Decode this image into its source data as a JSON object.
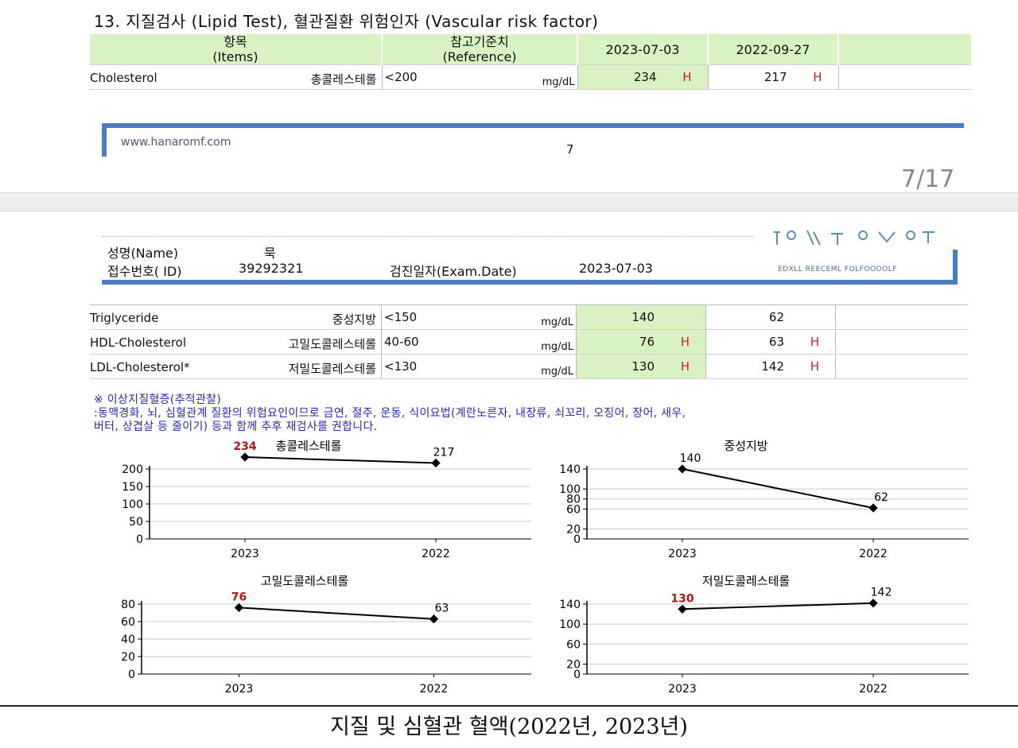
{
  "section_title": "13. 지질검사 (Lipid Test), 혈관질환 위험인자 (Vascular risk factor)",
  "header": {
    "items_ko": "항목",
    "items_en": "(Items)",
    "ref_ko": "참고기준치",
    "ref_en": "(Reference)",
    "date1": "2023-07-03",
    "date2": "2022-09-27"
  },
  "rows_top": [
    {
      "en": "Cholesterol",
      "ko": "총콜레스테롤",
      "ref": "<200",
      "unit": "mg/dL",
      "v1": "234",
      "f1": "H",
      "v2": "217",
      "f2": "H"
    }
  ],
  "footer_page": {
    "url": "www.hanaromf.com",
    "page_number": "7",
    "page_counter": "7/17"
  },
  "patient": {
    "name_label": "성명(Name)",
    "name_value": "묵",
    "id_label": "접수번호( ID)",
    "id_value": "39292321",
    "exam_label": "검진일자(Exam.Date)",
    "exam_value": "2023-07-03",
    "logo_text": "EDXLL REECEML FOLFOOOOLF"
  },
  "rows_bottom": [
    {
      "en": "Triglyceride",
      "ko": "중성지방",
      "ref": "<150",
      "unit": "mg/dL",
      "v1": "140",
      "f1": "",
      "v2": "62",
      "f2": ""
    },
    {
      "en": "HDL-Cholesterol",
      "ko": "고밀도콜레스테롤",
      "ref": "40-60",
      "unit": "mg/dL",
      "v1": "76",
      "f1": "H",
      "v2": "63",
      "f2": "H"
    },
    {
      "en": "LDL-Cholesterol*",
      "ko": "저밀도콜레스테롤",
      "ref": "<130",
      "unit": "mg/dL",
      "v1": "130",
      "f1": "H",
      "v2": "142",
      "f2": "H"
    }
  ],
  "note": {
    "line1": "※ 이상지질혈증(추적관찰)",
    "line2": ":동맥경화, 뇌, 심혈관계 질환의 위험요인이므로 금연, 절주, 운동, 식이요법(계란노른자, 내장류, 쇠꼬리, 오징어, 장어, 새우,",
    "line3": "버터, 상겹살 등 줄이기) 등과 함께 추후 재검사를 권합니다."
  },
  "chart_data": [
    {
      "type": "line",
      "title": "총콜레스테롤",
      "categories": [
        "2023",
        "2022"
      ],
      "values": [
        234,
        217
      ],
      "value_labels": [
        "234",
        "217"
      ],
      "ylim": [
        0,
        200
      ],
      "yticks": [
        0,
        50,
        100,
        150,
        200
      ],
      "highlight": [
        true,
        false
      ],
      "grid": true
    },
    {
      "type": "line",
      "title": "중성지방",
      "categories": [
        "2023",
        "2022"
      ],
      "values": [
        140,
        62
      ],
      "value_labels": [
        "140",
        "62"
      ],
      "ylim": [
        0,
        140
      ],
      "yticks": [
        0,
        20,
        60,
        80,
        100,
        140
      ],
      "highlight": [
        false,
        false
      ],
      "grid": true
    },
    {
      "type": "line",
      "title": "고밀도콜레스테롤",
      "categories": [
        "2023",
        "2022"
      ],
      "values": [
        76,
        63
      ],
      "value_labels": [
        "76",
        "63"
      ],
      "ylim": [
        0,
        80
      ],
      "yticks": [
        0,
        20,
        40,
        60,
        80
      ],
      "highlight": [
        true,
        false
      ],
      "grid": true
    },
    {
      "type": "line",
      "title": "저밀도콜레스테롤",
      "categories": [
        "2023",
        "2022"
      ],
      "values": [
        130,
        142
      ],
      "value_labels": [
        "130",
        "142"
      ],
      "ylim": [
        0,
        140
      ],
      "yticks": [
        0,
        20,
        60,
        100,
        140
      ],
      "highlight": [
        true,
        false
      ],
      "grid": true
    }
  ],
  "caption": "지질 및 심혈관 혈액(2022년, 2023년)",
  "colors": {
    "header_green": "#d9f2c4",
    "flag_red": "#d42020",
    "note_blue": "#2a2ab0",
    "accent_blue": "#4a7cc4"
  }
}
